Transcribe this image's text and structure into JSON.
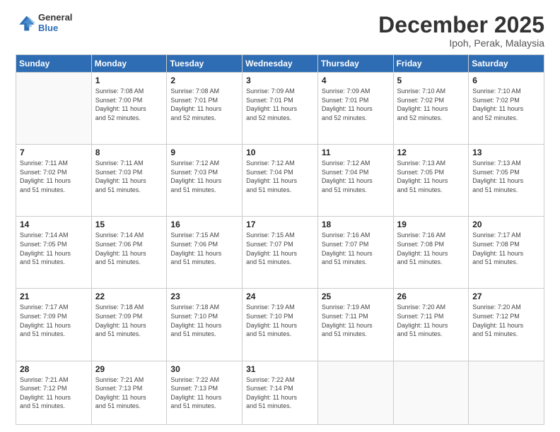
{
  "logo": {
    "line1": "General",
    "line2": "Blue"
  },
  "title": "December 2025",
  "location": "Ipoh, Perak, Malaysia",
  "days_header": [
    "Sunday",
    "Monday",
    "Tuesday",
    "Wednesday",
    "Thursday",
    "Friday",
    "Saturday"
  ],
  "weeks": [
    [
      {
        "day": "",
        "info": ""
      },
      {
        "day": "1",
        "info": "Sunrise: 7:08 AM\nSunset: 7:00 PM\nDaylight: 11 hours\nand 52 minutes."
      },
      {
        "day": "2",
        "info": "Sunrise: 7:08 AM\nSunset: 7:01 PM\nDaylight: 11 hours\nand 52 minutes."
      },
      {
        "day": "3",
        "info": "Sunrise: 7:09 AM\nSunset: 7:01 PM\nDaylight: 11 hours\nand 52 minutes."
      },
      {
        "day": "4",
        "info": "Sunrise: 7:09 AM\nSunset: 7:01 PM\nDaylight: 11 hours\nand 52 minutes."
      },
      {
        "day": "5",
        "info": "Sunrise: 7:10 AM\nSunset: 7:02 PM\nDaylight: 11 hours\nand 52 minutes."
      },
      {
        "day": "6",
        "info": "Sunrise: 7:10 AM\nSunset: 7:02 PM\nDaylight: 11 hours\nand 52 minutes."
      }
    ],
    [
      {
        "day": "7",
        "info": "Sunrise: 7:11 AM\nSunset: 7:02 PM\nDaylight: 11 hours\nand 51 minutes."
      },
      {
        "day": "8",
        "info": "Sunrise: 7:11 AM\nSunset: 7:03 PM\nDaylight: 11 hours\nand 51 minutes."
      },
      {
        "day": "9",
        "info": "Sunrise: 7:12 AM\nSunset: 7:03 PM\nDaylight: 11 hours\nand 51 minutes."
      },
      {
        "day": "10",
        "info": "Sunrise: 7:12 AM\nSunset: 7:04 PM\nDaylight: 11 hours\nand 51 minutes."
      },
      {
        "day": "11",
        "info": "Sunrise: 7:12 AM\nSunset: 7:04 PM\nDaylight: 11 hours\nand 51 minutes."
      },
      {
        "day": "12",
        "info": "Sunrise: 7:13 AM\nSunset: 7:05 PM\nDaylight: 11 hours\nand 51 minutes."
      },
      {
        "day": "13",
        "info": "Sunrise: 7:13 AM\nSunset: 7:05 PM\nDaylight: 11 hours\nand 51 minutes."
      }
    ],
    [
      {
        "day": "14",
        "info": "Sunrise: 7:14 AM\nSunset: 7:05 PM\nDaylight: 11 hours\nand 51 minutes."
      },
      {
        "day": "15",
        "info": "Sunrise: 7:14 AM\nSunset: 7:06 PM\nDaylight: 11 hours\nand 51 minutes."
      },
      {
        "day": "16",
        "info": "Sunrise: 7:15 AM\nSunset: 7:06 PM\nDaylight: 11 hours\nand 51 minutes."
      },
      {
        "day": "17",
        "info": "Sunrise: 7:15 AM\nSunset: 7:07 PM\nDaylight: 11 hours\nand 51 minutes."
      },
      {
        "day": "18",
        "info": "Sunrise: 7:16 AM\nSunset: 7:07 PM\nDaylight: 11 hours\nand 51 minutes."
      },
      {
        "day": "19",
        "info": "Sunrise: 7:16 AM\nSunset: 7:08 PM\nDaylight: 11 hours\nand 51 minutes."
      },
      {
        "day": "20",
        "info": "Sunrise: 7:17 AM\nSunset: 7:08 PM\nDaylight: 11 hours\nand 51 minutes."
      }
    ],
    [
      {
        "day": "21",
        "info": "Sunrise: 7:17 AM\nSunset: 7:09 PM\nDaylight: 11 hours\nand 51 minutes."
      },
      {
        "day": "22",
        "info": "Sunrise: 7:18 AM\nSunset: 7:09 PM\nDaylight: 11 hours\nand 51 minutes."
      },
      {
        "day": "23",
        "info": "Sunrise: 7:18 AM\nSunset: 7:10 PM\nDaylight: 11 hours\nand 51 minutes."
      },
      {
        "day": "24",
        "info": "Sunrise: 7:19 AM\nSunset: 7:10 PM\nDaylight: 11 hours\nand 51 minutes."
      },
      {
        "day": "25",
        "info": "Sunrise: 7:19 AM\nSunset: 7:11 PM\nDaylight: 11 hours\nand 51 minutes."
      },
      {
        "day": "26",
        "info": "Sunrise: 7:20 AM\nSunset: 7:11 PM\nDaylight: 11 hours\nand 51 minutes."
      },
      {
        "day": "27",
        "info": "Sunrise: 7:20 AM\nSunset: 7:12 PM\nDaylight: 11 hours\nand 51 minutes."
      }
    ],
    [
      {
        "day": "28",
        "info": "Sunrise: 7:21 AM\nSunset: 7:12 PM\nDaylight: 11 hours\nand 51 minutes."
      },
      {
        "day": "29",
        "info": "Sunrise: 7:21 AM\nSunset: 7:13 PM\nDaylight: 11 hours\nand 51 minutes."
      },
      {
        "day": "30",
        "info": "Sunrise: 7:22 AM\nSunset: 7:13 PM\nDaylight: 11 hours\nand 51 minutes."
      },
      {
        "day": "31",
        "info": "Sunrise: 7:22 AM\nSunset: 7:14 PM\nDaylight: 11 hours\nand 51 minutes."
      },
      {
        "day": "",
        "info": ""
      },
      {
        "day": "",
        "info": ""
      },
      {
        "day": "",
        "info": ""
      }
    ]
  ]
}
